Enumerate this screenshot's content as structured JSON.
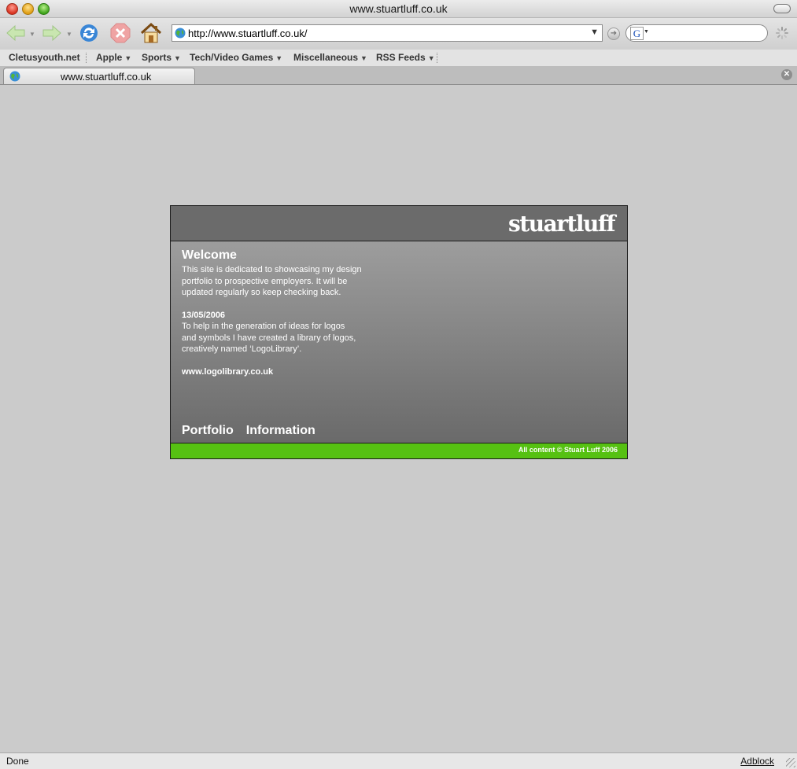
{
  "window": {
    "title": "www.stuartluff.co.uk"
  },
  "toolbar": {
    "url": "http://www.stuartluff.co.uk/",
    "search_value": ""
  },
  "bookmarks": [
    {
      "label": "Cletusyouth.net",
      "dropdown": false
    },
    {
      "label": "Apple",
      "dropdown": true
    },
    {
      "label": "Sports",
      "dropdown": true
    },
    {
      "label": "Tech/Video Games",
      "dropdown": true
    },
    {
      "label": "Miscellaneous",
      "dropdown": true
    },
    {
      "label": "RSS Feeds",
      "dropdown": true
    }
  ],
  "tabs": [
    {
      "title": "www.stuartluff.co.uk"
    }
  ],
  "page": {
    "logo": "stuartluff",
    "welcome_heading": "Welcome",
    "intro_lines": [
      "This site is dedicated to showcasing my design",
      "portfolio to prospective employers. It will be",
      "updated regularly so keep checking back."
    ],
    "news_date": "13/05/2006",
    "news_lines": [
      "To help in the generation of ideas for logos",
      "and symbols I have created a library of logos,",
      "creatively named ‘LogoLibrary’."
    ],
    "link_text": "www.logolibrary.co.uk",
    "nav": [
      "Portfolio",
      "Information"
    ],
    "footer": "All content © Stuart Luff 2006",
    "colors": {
      "footer_green": "#56c112",
      "header_gray": "#6b6b6b"
    }
  },
  "status": {
    "text": "Done",
    "addon": "Adblock"
  },
  "icons": [
    "back-arrow-icon",
    "forward-arrow-icon",
    "reload-icon",
    "stop-icon",
    "home-icon",
    "globe-icon",
    "go-arrow-icon",
    "google-icon",
    "throbber-icon",
    "tab-close-icon"
  ]
}
